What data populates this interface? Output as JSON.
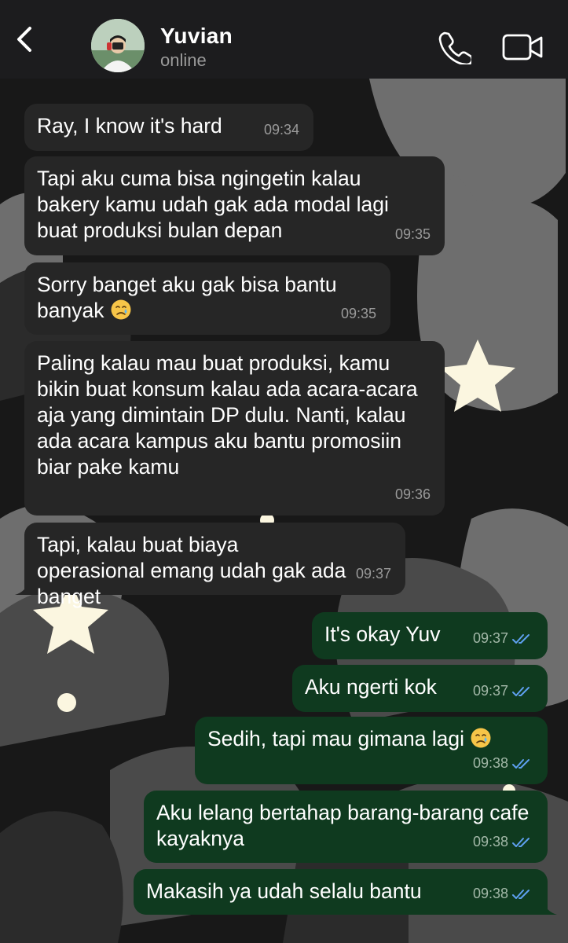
{
  "header": {
    "contact_name": "Yuvian",
    "status": "online"
  },
  "icons": {
    "back": "chevron-left-icon",
    "call": "phone-icon",
    "video": "video-camera-icon",
    "read_receipt": "double-check-icon",
    "emoji": "crying-face-emoji"
  },
  "colors": {
    "incoming_bubble": "#262626",
    "outgoing_bubble": "#0f3a1f",
    "read_tick": "#5ea0f0"
  },
  "messages": [
    {
      "dir": "in",
      "text": "Ray, I know it's hard",
      "time": "09:34"
    },
    {
      "dir": "in",
      "text": "Tapi aku cuma bisa ngingetin kalau bakery kamu udah gak ada modal lagi buat produksi bulan depan",
      "time": "09:35"
    },
    {
      "dir": "in",
      "text": "Sorry banget aku gak bisa bantu banyak",
      "emoji": "🥲",
      "time": "09:35"
    },
    {
      "dir": "in",
      "text": "Paling kalau mau buat produksi, kamu bikin buat konsum kalau ada acara-acara aja yang dimintain DP dulu. Nanti, kalau ada acara kampus aku bantu promosiin biar pake kamu",
      "time": "09:36"
    },
    {
      "dir": "in",
      "text": "Tapi, kalau buat biaya operasional emang udah gak ada banget",
      "time": "09:37"
    },
    {
      "dir": "out",
      "text": "It's okay Yuv",
      "time": "09:37",
      "read": true
    },
    {
      "dir": "out",
      "text": "Aku ngerti kok",
      "time": "09:37",
      "read": true
    },
    {
      "dir": "out",
      "text": "Sedih, tapi mau gimana lagi",
      "emoji": "🥲",
      "time": "09:38",
      "read": true
    },
    {
      "dir": "out",
      "text": "Aku lelang bertahap barang-barang cafe kayaknya",
      "time": "09:38",
      "read": true
    },
    {
      "dir": "out",
      "text": "Makasih ya udah selalu bantu",
      "time": "09:38",
      "read": true
    }
  ]
}
